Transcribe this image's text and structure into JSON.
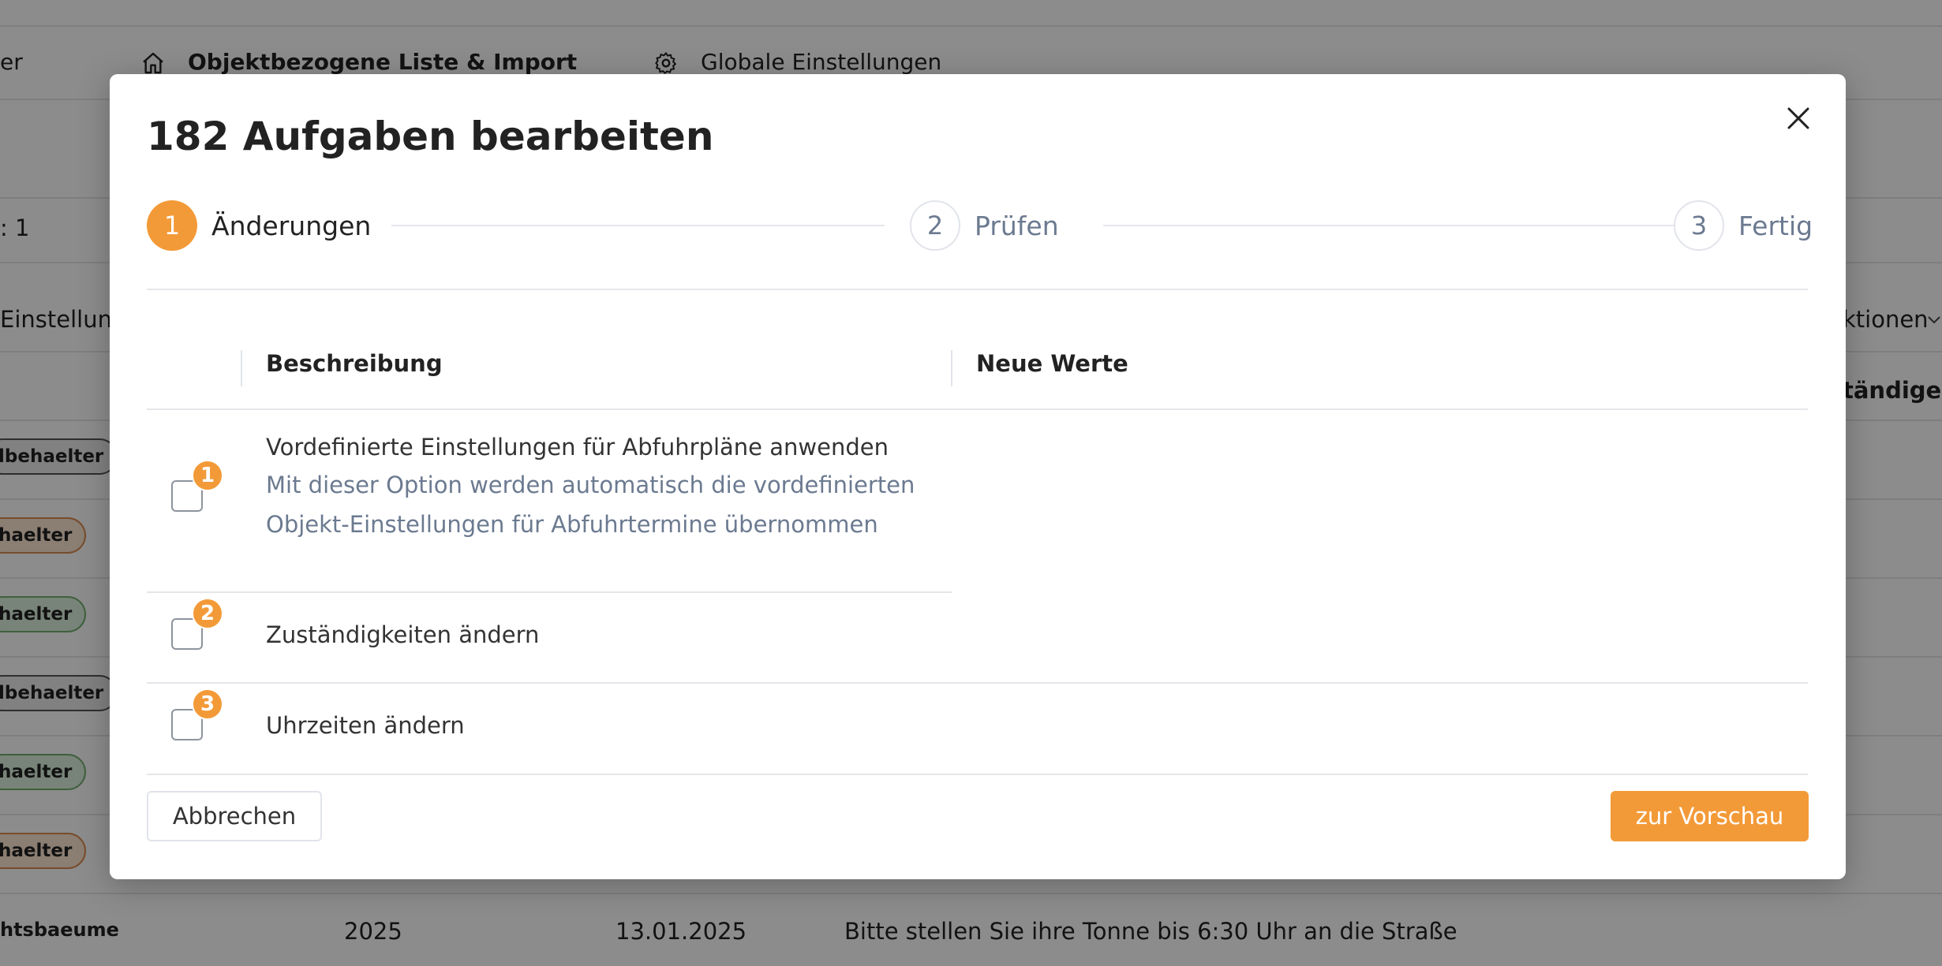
{
  "background": {
    "nav": {
      "truncated_left": "er",
      "list_import": "Objektbezogene Liste & Import",
      "global_settings": "Globale Einstellungen"
    },
    "row_label": ": 1",
    "settings_tab": "Einstellung",
    "actions_label": "ktionen",
    "column_header_right": "tändige M",
    "pills": [
      {
        "label": "lbehaelter",
        "color": "gray"
      },
      {
        "label": "haelter",
        "color": "orange"
      },
      {
        "label": "haelter",
        "color": "green"
      },
      {
        "label": "lbehaelter",
        "color": "gray"
      },
      {
        "label": "haelter",
        "color": "green"
      },
      {
        "label": "haelter",
        "color": "orange"
      }
    ],
    "last_row": {
      "name": "htsbaeume",
      "year": "2025",
      "date": "13.01.2025",
      "note": "Bitte stellen Sie ihre Tonne bis 6:30 Uhr an die Straße"
    }
  },
  "modal": {
    "title": "182 Aufgaben bearbeiten",
    "steps": [
      {
        "number": "1",
        "label": "Änderungen",
        "active": true
      },
      {
        "number": "2",
        "label": "Prüfen",
        "active": false
      },
      {
        "number": "3",
        "label": "Fertig",
        "active": false
      }
    ],
    "columns": {
      "description": "Beschreibung",
      "new_values": "Neue Werte"
    },
    "rows": [
      {
        "badge": "1",
        "title": "Vordefinierte Einstellungen für Abfuhrpläne anwenden",
        "description_lines": [
          "Mit dieser Option werden automatisch die vordefinierten",
          "Objekt-Einstellungen für Abfuhrtermine übernommen"
        ]
      },
      {
        "badge": "2",
        "title": "Zuständigkeiten ändern"
      },
      {
        "badge": "3",
        "title": "Uhrzeiten ändern"
      }
    ],
    "cancel_label": "Abbrechen",
    "preview_label": "zur Vorschau"
  },
  "colors": {
    "accent": "#f39a38",
    "muted_text": "#6b7a90"
  }
}
